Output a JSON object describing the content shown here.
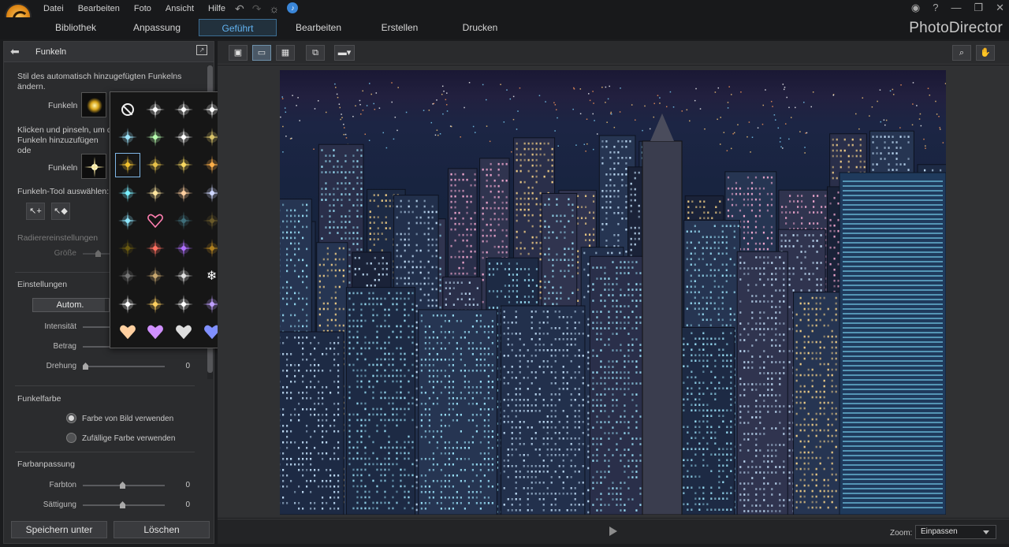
{
  "menu": [
    "Datei",
    "Bearbeiten",
    "Foto",
    "Ansicht",
    "Hilfe"
  ],
  "modules": {
    "items": [
      "Bibliothek",
      "Anpassung",
      "Geführt",
      "Bearbeiten",
      "Erstellen",
      "Drucken"
    ],
    "active": "Geführt"
  },
  "brand": "PhotoDirector",
  "window_controls": [
    "?",
    "—",
    "❐",
    "✕"
  ],
  "panel": {
    "title": "Funkeln",
    "auto_desc": "Stil des automatisch hinzugefügten Funkelns ändern.",
    "sparkle_label_1": "Funkeln",
    "click_desc": "Klicken und pinseln, um d Funkeln hinzuzufügen ode",
    "sparkle_label_2": "Funkeln",
    "tool_label": "Funkeln-Tool auswählen:",
    "eraser_label": "Radierereinstellungen",
    "eraser_size_label": "Größe",
    "settings_label": "Einstellungen",
    "auto_button": "Autom.",
    "intensity_label": "Intensität",
    "amount_label": "Betrag",
    "rotation_label": "Drehung",
    "rotation_value": "0",
    "color_label": "Funkelfarbe",
    "color_opt_1": "Farbe von Bild verwenden",
    "color_opt_2": "Zufällige Farbe verwenden",
    "color_adjust_label": "Farbanpassung",
    "hue_label": "Farbton",
    "hue_value": "0",
    "saturation_label": "Sättigung",
    "saturation_value": "0",
    "save_button": "Speichern unter",
    "delete_button": "Löschen"
  },
  "zoom": {
    "label": "Zoom:",
    "value": "Einpassen"
  },
  "colors": {
    "accent": "#63b4f2",
    "panel": "#2b2c2e",
    "background": "#1b1c1e"
  }
}
